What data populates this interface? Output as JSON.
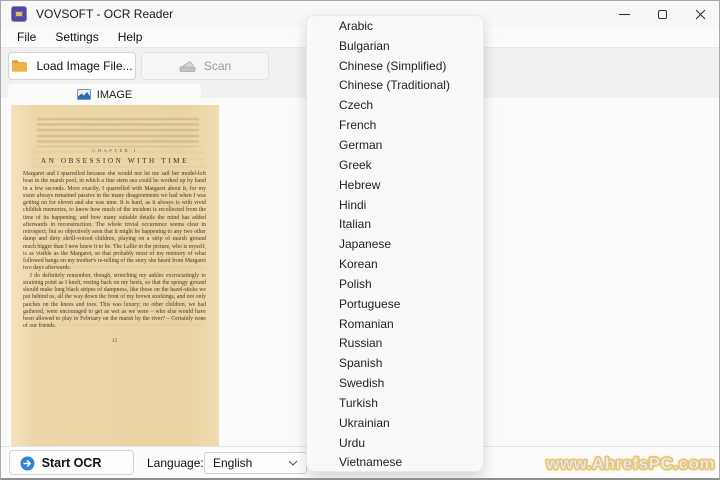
{
  "window": {
    "title": "VOVSOFT - OCR Reader"
  },
  "icons": {
    "close": "✕",
    "start_arrow": "→",
    "app_logo": "vovsoft-chip"
  },
  "menu": {
    "items": [
      "File",
      "Settings",
      "Help"
    ]
  },
  "toolbar": {
    "load_image_label": "Load Image File...",
    "scan_label": "Scan"
  },
  "tab": {
    "label": "IMAGE"
  },
  "scanned_page": {
    "chapter_label": "CHAPTER I",
    "title": "AN OBSESSION WITH TIME",
    "paragraphs": [
      "Margaret and I quarrelled because she would not let me sail her model-loft boat in the marsh pool, in which a fine stern sea could be worked up by hand in a few seconds. More exactly, I quarrelled with Margaret about it, for my sister always remained passive in the many disagreements we had when I was getting on for eleven and she was nine. It is hard, as it always is with vivid childish memories, to know how much of the incident is recollected from the time of its happening, and how many suitable details the mind has added afterwards in reconstruction. The whole trivial occurrence seems clear in retrospect, but so objectively seen that it might be happening to any two other damp and dirty shrill-voiced children, playing on a strip of marsh ground much bigger than I now knew it to be. The Lallie in the picture, who is myself, is as visible as the Margaret, so that probably most of my memory of what followed hangs on my mother's re-telling of the story she heard from Margaret two days afterwards.",
      "I do definitely remember, though, stretching my ankles excruciatingly to straining point as I knelt, resting back on my heels, so that the spongy ground should make long black stripes of dampness, like those on the hazel-sticks we put behind us, all the way down the front of my brown stockings, and not only patches on the knees and toes. This was luxury; no other children, we had gathered, were encouraged to get as wet as we were – who else would have been allowed to play in February on the marsh by the river? – Certainly none of our friends."
    ],
    "page_number": "15"
  },
  "language_popup": {
    "items": [
      "Arabic",
      "Bulgarian",
      "Chinese (Simplified)",
      "Chinese (Traditional)",
      "Czech",
      "French",
      "German",
      "Greek",
      "Hebrew",
      "Hindi",
      "Italian",
      "Japanese",
      "Korean",
      "Polish",
      "Portuguese",
      "Romanian",
      "Russian",
      "Spanish",
      "Swedish",
      "Turkish",
      "Ukrainian",
      "Urdu",
      "Vietnamese"
    ]
  },
  "bottom_bar": {
    "start_ocr_label": "Start OCR",
    "language_label": "Language:",
    "language_value": "English"
  },
  "watermark": {
    "text": "www.AhrefsPC.com"
  },
  "colors": {
    "accent_blue": "#2e83d4",
    "folder_orange": "#f0a63a",
    "page_cream": "#ecd9ad",
    "watermark_yellow": "#f1c75f",
    "app_icon_purple": "#54489a"
  }
}
